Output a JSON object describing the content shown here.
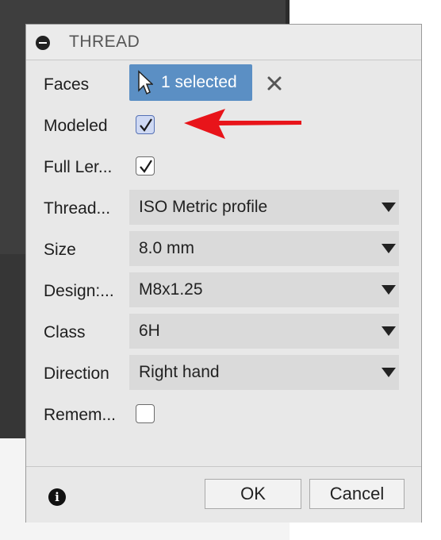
{
  "dialog": {
    "title": "THREAD",
    "faces": {
      "label": "Faces",
      "selection": "1 selected"
    },
    "modeled": {
      "label": "Modeled",
      "checked": true
    },
    "full_length": {
      "label": "Full Ler...",
      "checked": true
    },
    "thread_type": {
      "label": "Thread...",
      "value": "ISO Metric profile"
    },
    "size": {
      "label": "Size",
      "value": "8.0 mm"
    },
    "designation": {
      "label": "Design:...",
      "value": "M8x1.25"
    },
    "class": {
      "label": "Class",
      "value": "6H"
    },
    "direction": {
      "label": "Direction",
      "value": "Right hand"
    },
    "remember": {
      "label": "Remem...",
      "checked": false
    },
    "footer": {
      "ok_label": "OK",
      "cancel_label": "Cancel"
    }
  },
  "icons": [
    "collapse-icon",
    "cursor-icon",
    "close-icon",
    "checkmark-icon",
    "dropdown-arrow-icon",
    "info-icon",
    "red-arrow-annotation"
  ],
  "colors": {
    "selection_chip": "#5b8fc4",
    "annotation_arrow": "#e8141a",
    "dialog_bg": "#e8e8e8",
    "select_bg": "#dadada"
  }
}
